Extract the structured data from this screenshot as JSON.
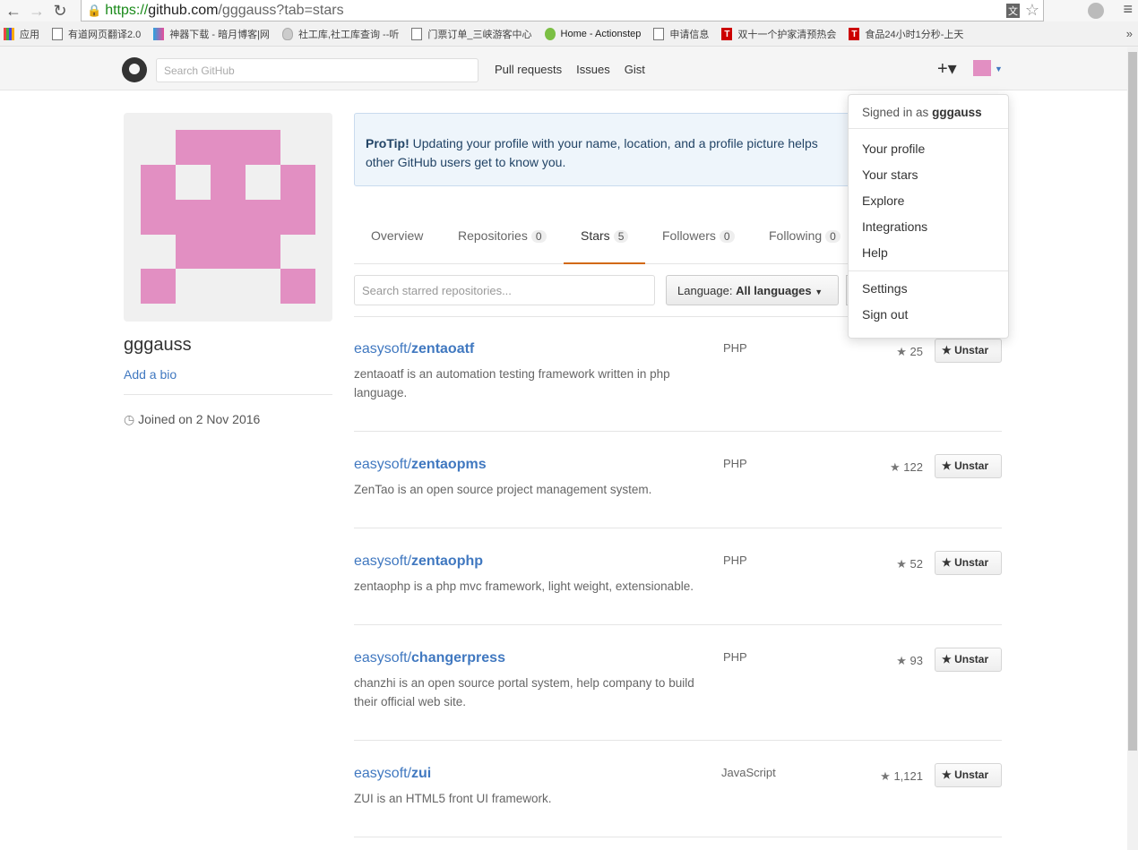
{
  "browser": {
    "url_https": "https://",
    "url_domain": "github.com",
    "url_path": "/gggauss?tab=stars",
    "bookmarks": [
      "应用",
      "有道网页翻译2.0",
      "神器下载 - 暗月博客|网",
      "社工库,社工库查询 --听",
      "门票订单_三峡游客中心",
      "Home - Actionstep",
      "申请信息",
      "双十一个护家清预热会",
      "食品24小时1分秒-上天"
    ],
    "more": "»"
  },
  "header": {
    "search_placeholder": "Search GitHub",
    "nav": [
      "Pull requests",
      "Issues",
      "Gist"
    ],
    "plus": "+▾"
  },
  "dropdown": {
    "signed_prefix": "Signed in as",
    "user": "gggauss",
    "items": [
      "Your profile",
      "Your stars",
      "Explore",
      "Integrations",
      "Help"
    ],
    "items2": [
      "Settings",
      "Sign out"
    ]
  },
  "profile": {
    "username": "gggauss",
    "add_bio": "Add a bio",
    "joined": "Joined on 2 Nov 2016",
    "avatar_color": "#e28fc2"
  },
  "protip": {
    "label": "ProTip!",
    "text": "Updating your profile with your name, location, and a profile picture helps other GitHub users get to know you."
  },
  "tabs": [
    {
      "label": "Overview",
      "count": null
    },
    {
      "label": "Repositories",
      "count": "0"
    },
    {
      "label": "Stars",
      "count": "5"
    },
    {
      "label": "Followers",
      "count": "0"
    },
    {
      "label": "Following",
      "count": "0"
    }
  ],
  "filter": {
    "search_placeholder": "Search starred repositories...",
    "language_label": "Language:",
    "language_value": "All languages"
  },
  "repos": [
    {
      "owner": "easysoft/",
      "name": "zentaoatf",
      "desc": "zentaoatf is an automation testing framework written in php language.",
      "lang": "PHP",
      "stars": "25",
      "button": "Unstar"
    },
    {
      "owner": "easysoft/",
      "name": "zentaopms",
      "desc": "ZenTao is an open source project management system.",
      "lang": "PHP",
      "stars": "122",
      "button": "Unstar"
    },
    {
      "owner": "easysoft/",
      "name": "zentaophp",
      "desc": "zentaophp is a php mvc framework, light weight, extensionable.",
      "lang": "PHP",
      "stars": "52",
      "button": "Unstar"
    },
    {
      "owner": "easysoft/",
      "name": "changerpress",
      "desc": "chanzhi is an open source portal system, help company to build their official web site.",
      "lang": "PHP",
      "stars": "93",
      "button": "Unstar"
    },
    {
      "owner": "easysoft/",
      "name": "zui",
      "desc": "ZUI is an HTML5 front UI framework.",
      "lang": "JavaScript",
      "stars": "1,121",
      "button": "Unstar"
    }
  ]
}
